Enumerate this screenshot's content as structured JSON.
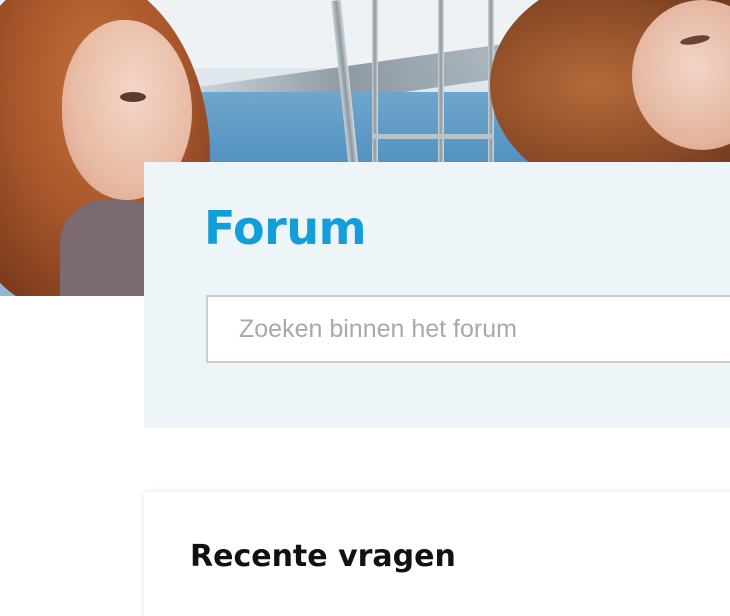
{
  "forum": {
    "title": "Forum",
    "search_placeholder": "Zoeken binnen het forum",
    "search_value": ""
  },
  "recent": {
    "title": "Recente vragen"
  },
  "colors": {
    "title_blue": "#129ed9",
    "panel_bg": "#edf5f9",
    "search_border": "#c9cdd0"
  }
}
